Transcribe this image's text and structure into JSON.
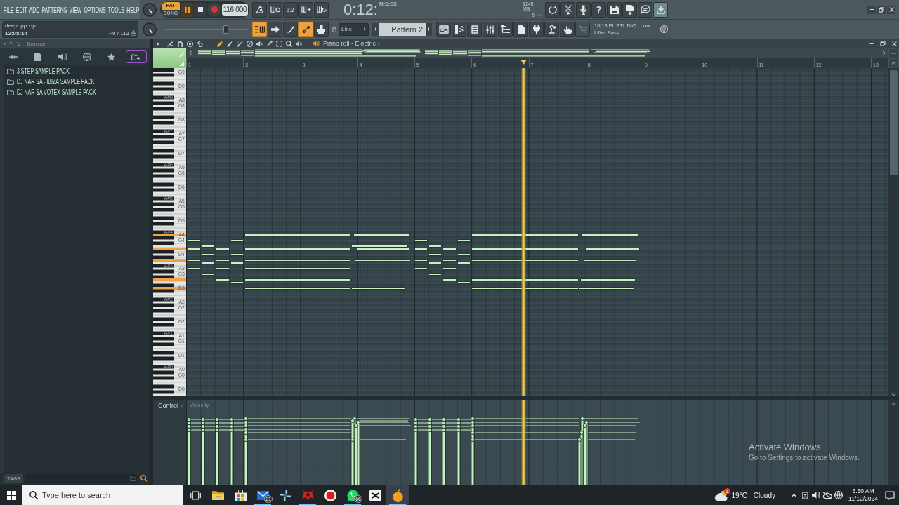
{
  "menu": [
    "FILE",
    "EDIT",
    "ADD",
    "PATTERNS",
    "VIEW",
    "OPTIONS",
    "TOOLS",
    "HELP"
  ],
  "transport": {
    "modes": [
      {
        "label": "PAT",
        "selected": true
      },
      {
        "label": "SONG",
        "selected": false
      }
    ],
    "playing": true,
    "recording": false,
    "tempo": "116.000"
  },
  "record_tools": {
    "count_in": "32",
    "buttons": [
      {
        "on": false
      },
      {
        "on": false
      },
      {
        "on": false
      },
      {
        "on": false
      },
      {
        "on": false
      }
    ]
  },
  "time": {
    "value": "0:12:",
    "format": "M:S:CS"
  },
  "monitor": {
    "memory": "1245 MB",
    "voices": "5"
  },
  "app_tools": {
    "help": "?",
    "buttons": [
      {
        "highlighted": false
      },
      {
        "highlighted": false
      },
      {
        "highlighted": false
      },
      {
        "highlighted": false
      },
      {
        "highlighted": false
      },
      {
        "highlighted": false
      },
      {
        "highlighted": false
      },
      {
        "highlighted": true
      }
    ]
  },
  "hint": {
    "file": "deepppp.zip",
    "time": "12:05:14",
    "counter": "F9 / 113"
  },
  "main_slider": {
    "level": 0.73
  },
  "edit_tools": [
    {
      "on": true
    },
    {
      "on": false
    },
    {
      "on": false
    },
    {
      "on": true
    },
    {
      "on": false
    }
  ],
  "snap": "Line",
  "pattern": "Pattern 2",
  "view_buttons": [
    {
      "disabled": false
    },
    {
      "disabled": false
    },
    {
      "disabled": false
    },
    {
      "disabled": false
    },
    {
      "disabled": false
    },
    {
      "disabled": false
    },
    {
      "disabled": false
    },
    {
      "disabled": false
    },
    {
      "disabled": false
    },
    {
      "disabled": true
    }
  ],
  "news": "10/18 FL STUDIO | Low Lifter Bass",
  "browser": {
    "title": "Browser",
    "tabs": [
      {
        "selected": false
      },
      {
        "selected": false
      },
      {
        "selected": false
      },
      {
        "selected": false
      },
      {
        "selected": false
      },
      {
        "selected": true
      }
    ],
    "items": [
      "3 STEP SAMPLE PACK",
      "DJ NAR SA - IBIZA SAMPLE PACK",
      "DJ NAR SA VOTEX SAMPLE PACK"
    ],
    "tags_label": "TAGS"
  },
  "piano_roll": {
    "title": "Piano roll - Electric",
    "tools": [
      {
        "selected": true
      },
      {
        "selected": false
      },
      {
        "selected": false
      },
      {
        "selected": false
      },
      {
        "selected": false
      },
      {
        "selected": false
      },
      {
        "selected": false
      },
      {
        "selected": false
      },
      {
        "selected": false
      }
    ],
    "bars": [
      "1",
      "2",
      "3",
      "4",
      "5",
      "6",
      "7",
      "8",
      "9",
      "10",
      "11",
      "12",
      "13"
    ],
    "key_labels": [
      "G9",
      "D9",
      "A8",
      "G8",
      "D8",
      "A7",
      "G7",
      "D7",
      "A6",
      "G6",
      "D6",
      "A5",
      "G5",
      "D5",
      "A4",
      "G4",
      "D4",
      "A3",
      "G3",
      "D3",
      "A2",
      "G2",
      "D2",
      "A1",
      "G1",
      "D1",
      "A0",
      "G0",
      "D0"
    ],
    "black_key_labels": [
      "A#8",
      "A#7",
      "A#6",
      "A#5",
      "A#4",
      "A#3",
      "A#2",
      "A#1",
      "A#0"
    ],
    "control_label": "Control",
    "control_target": "Velocity"
  },
  "taskbar": {
    "search_placeholder": "Type here to search",
    "apps": [
      {
        "running": false,
        "active": false
      },
      {
        "running": false,
        "active": false
      },
      {
        "running": true,
        "active": false,
        "badge": "21"
      },
      {
        "running": false,
        "active": false
      },
      {
        "running": true,
        "active": false
      },
      {
        "running": false,
        "active": false
      },
      {
        "running": true,
        "active": false,
        "badge": "66"
      },
      {
        "running": false,
        "active": false
      },
      {
        "running": true,
        "active": true
      }
    ],
    "weather": {
      "badge": "1",
      "temperature": "19°C",
      "condition": "Cloudy"
    },
    "clock": {
      "time": "5:50 AM",
      "date": "11/12/2024"
    }
  },
  "activation": {
    "title": "Activate Windows",
    "subtitle": "Go to Settings to activate Windows."
  }
}
